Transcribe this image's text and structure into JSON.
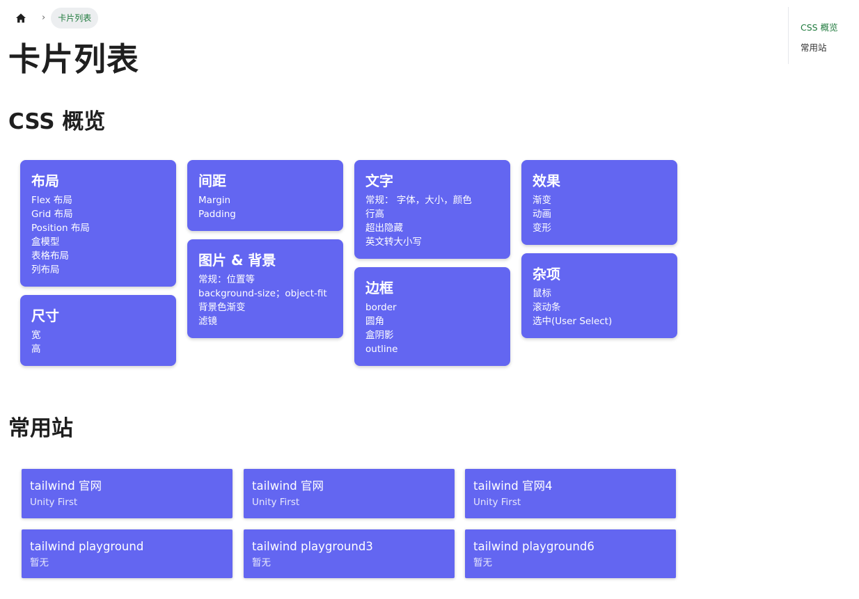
{
  "breadcrumb": {
    "home_icon": "home-icon",
    "separator": "›",
    "current": "卡片列表"
  },
  "page_title": "卡片列表",
  "sections": {
    "css_overview": {
      "title": "CSS 概览",
      "cards": [
        {
          "title": "布局",
          "items": [
            "Flex 布局",
            "Grid 布局",
            "Position 布局",
            "盒模型",
            "表格布局",
            "列布局"
          ]
        },
        {
          "title": "尺寸",
          "items": [
            "宽",
            "高"
          ]
        },
        {
          "title": "间距",
          "items": [
            "Margin",
            "Padding"
          ]
        },
        {
          "title": "图片 & 背景",
          "items": [
            "常规：位置等",
            "background-size；object-fit",
            "背景色渐变",
            "滤镜"
          ]
        },
        {
          "title": "文字",
          "items": [
            "常规： 字体，大小，颜色",
            "行高",
            "超出隐藏",
            "英文转大小写"
          ]
        },
        {
          "title": "边框",
          "items": [
            "border",
            "圆角",
            "盒阴影",
            "outline"
          ]
        },
        {
          "title": "效果",
          "items": [
            "渐变",
            "动画",
            "变形"
          ]
        },
        {
          "title": "杂项",
          "items": [
            "鼠标",
            "滚动条",
            "选中(User Select)"
          ]
        }
      ]
    },
    "common_sites": {
      "title": "常用站",
      "sites": [
        {
          "name": "tailwind 官网",
          "desc": "Unity First"
        },
        {
          "name": "tailwind 官网",
          "desc": "Unity First"
        },
        {
          "name": "tailwind 官网4",
          "desc": "Unity First"
        },
        {
          "name": "tailwind playground",
          "desc": "暂无"
        },
        {
          "name": "tailwind playground3",
          "desc": "暂无"
        },
        {
          "name": "tailwind playground6",
          "desc": "暂无"
        }
      ]
    }
  },
  "toc": {
    "items": [
      "CSS 概览",
      "常用站"
    ],
    "active_index": 0
  },
  "colors": {
    "card_bg": "#6366f1",
    "toc_active": "#1f7a3d",
    "crumb_bg": "#eceef0"
  }
}
